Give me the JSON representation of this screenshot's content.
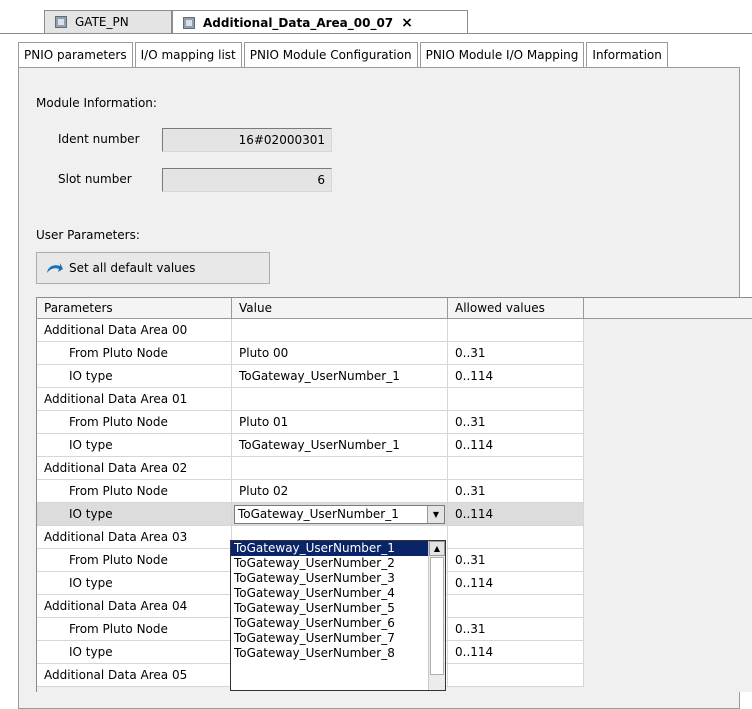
{
  "doc_tabs": [
    {
      "label": "GATE_PN",
      "active": false
    },
    {
      "label": "Additional_Data_Area_00_07",
      "active": true,
      "close": "×"
    }
  ],
  "sub_tabs": [
    "PNIO parameters",
    "I/O mapping list",
    "PNIO Module Configuration",
    "PNIO Module I/O Mapping",
    "Information"
  ],
  "module_info": {
    "title": "Module Information:",
    "ident_label": "Ident number",
    "ident_value": "16#02000301",
    "slot_label": "Slot number",
    "slot_value": "6"
  },
  "user_params": {
    "title": "User Parameters:",
    "default_button": "Set all default values"
  },
  "grid": {
    "headers": [
      "Parameters",
      "Value",
      "Allowed values"
    ],
    "rows": [
      {
        "param": "Additional Data Area 00",
        "value": "",
        "allowed": "",
        "indent": false
      },
      {
        "param": "From Pluto Node",
        "value": "Pluto 00",
        "allowed": "0..31",
        "indent": true
      },
      {
        "param": "IO type",
        "value": "ToGateway_UserNumber_1",
        "allowed": "0..114",
        "indent": true
      },
      {
        "param": "Additional Data Area 01",
        "value": "",
        "allowed": "",
        "indent": false
      },
      {
        "param": "From Pluto Node",
        "value": "Pluto 01",
        "allowed": "0..31",
        "indent": true
      },
      {
        "param": "IO type",
        "value": "ToGateway_UserNumber_1",
        "allowed": "0..114",
        "indent": true
      },
      {
        "param": "Additional Data Area 02",
        "value": "",
        "allowed": "",
        "indent": false
      },
      {
        "param": "From Pluto Node",
        "value": "Pluto 02",
        "allowed": "0..31",
        "indent": true
      },
      {
        "param": "IO type",
        "value": "ToGateway_UserNumber_1",
        "allowed": "0..114",
        "indent": true,
        "selected": true
      },
      {
        "param": "Additional Data Area 03",
        "value": "",
        "allowed": "",
        "indent": false
      },
      {
        "param": "From Pluto Node",
        "value": "",
        "allowed": "0..31",
        "indent": true
      },
      {
        "param": "IO type",
        "value": "",
        "allowed": "0..114",
        "indent": true
      },
      {
        "param": "Additional Data Area 04",
        "value": "",
        "allowed": "",
        "indent": false
      },
      {
        "param": "From Pluto Node",
        "value": "",
        "allowed": "0..31",
        "indent": true
      },
      {
        "param": "IO type",
        "value": "",
        "allowed": "0..114",
        "indent": true
      },
      {
        "param": "Additional Data Area 05",
        "value": "",
        "allowed": "",
        "indent": false
      }
    ]
  },
  "dropdown": {
    "selected": "ToGateway_UserNumber_1",
    "options": [
      "ToGateway_UserNumber_1",
      "ToGateway_UserNumber_2",
      "ToGateway_UserNumber_3",
      "ToGateway_UserNumber_4",
      "ToGateway_UserNumber_5",
      "ToGateway_UserNumber_6",
      "ToGateway_UserNumber_7",
      "ToGateway_UserNumber_8"
    ],
    "highlight_color": "#0a246a"
  }
}
